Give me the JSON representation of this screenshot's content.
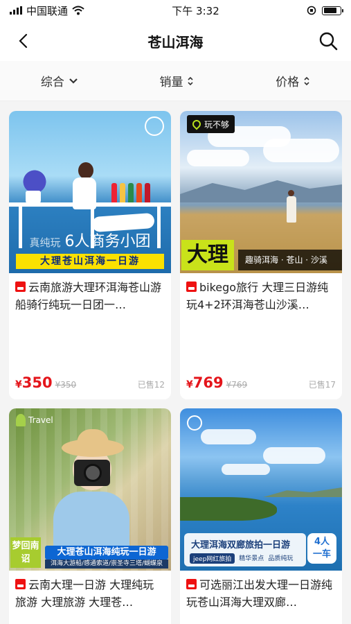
{
  "status": {
    "carrier": "中国联通",
    "time": "下午 3:32"
  },
  "nav": {
    "title": "苍山洱海"
  },
  "filters": {
    "sort": "综合",
    "sales": "销量",
    "price": "价格"
  },
  "products": [
    {
      "title": "云南旅游大理环洱海苍山游船骑行纯玩一日团一…",
      "price_symbol": "¥",
      "price": "350",
      "original_price": "¥350",
      "sold": "已售12",
      "image": {
        "pre": "真纯玩",
        "headline": "6人商务小团",
        "banner": "大理苍山洱海一日游"
      }
    },
    {
      "title": "bikego旅行 大理三日游纯玩4+2环洱海苍山沙溪…",
      "price_symbol": "¥",
      "price": "769",
      "original_price": "¥769",
      "sold": "已售17",
      "image": {
        "brand": "玩不够",
        "big": "大理",
        "tagline": "趣骑洱海 · 苍山 · 沙溪"
      }
    },
    {
      "title": "云南大理一日游 大理纯玩旅游 大理旅游 大理苍…",
      "image": {
        "brand": "Travel",
        "side": "梦回南诏",
        "banner": "大理苍山洱海纯玩一日游",
        "sub": "洱海大游船/感通索道/崇圣寺三塔/蝴蝶泉"
      }
    },
    {
      "title": "可选丽江出发大理一日游纯玩苍山洱海大理双廊…",
      "image": {
        "panel_title": "大理洱海双廊旅拍一日游",
        "tag1": "jeep网红旅拍",
        "tag2": "精华景点",
        "tag3": "品质纯玩",
        "badge_line1": "4人",
        "badge_line2": "一车"
      }
    }
  ],
  "colors": {
    "price": "#e4151b",
    "accent_yellow": "#fbe100",
    "accent_green": "#c9e21a"
  }
}
